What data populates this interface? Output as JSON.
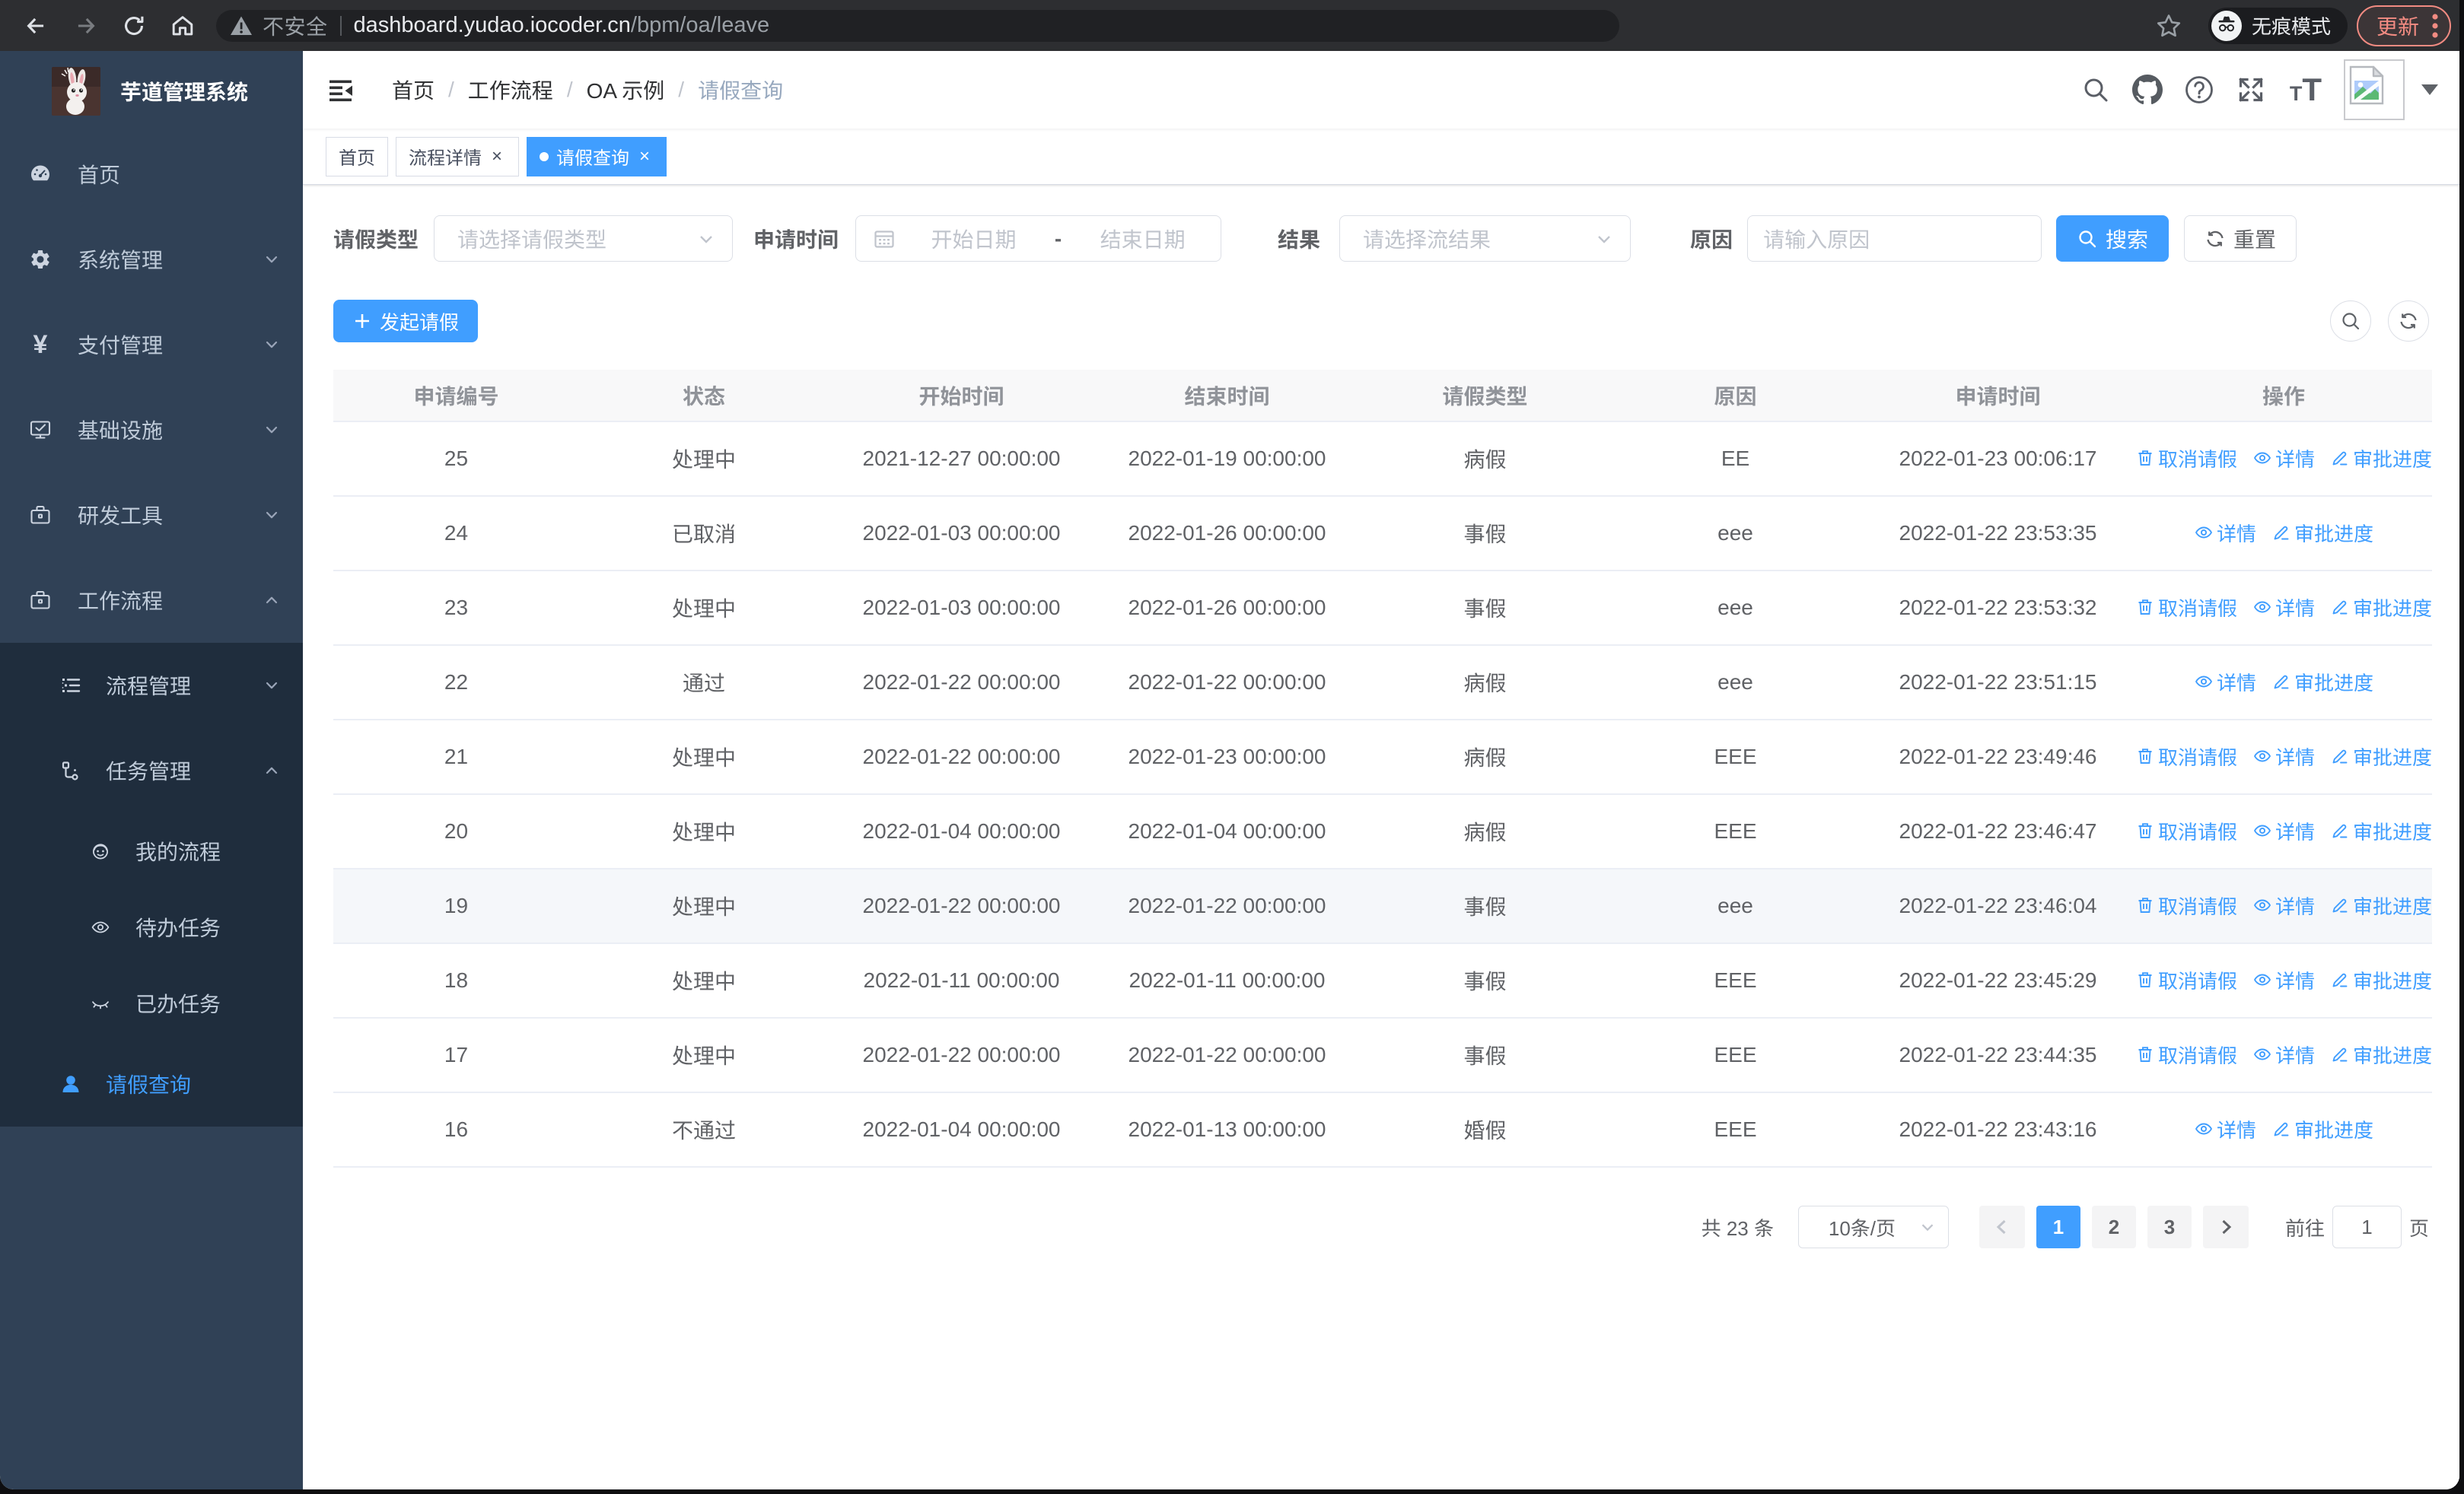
{
  "browser": {
    "security_label": "不安全",
    "url_host": "dashboard.yudao.iocoder.cn",
    "url_path": "/bpm/oa/leave",
    "incognito_label": "无痕模式",
    "update_label": "更新"
  },
  "sidebar": {
    "app_title": "芋道管理系统",
    "menu": [
      {
        "label": "首页",
        "icon": "dashboard-icon",
        "level": 1,
        "arrow": null,
        "dark": false,
        "active": false
      },
      {
        "label": "系统管理",
        "icon": "gear-icon",
        "level": 1,
        "arrow": "down",
        "dark": false,
        "active": false
      },
      {
        "label": "支付管理",
        "icon": "yen-icon",
        "level": 1,
        "arrow": "down",
        "dark": false,
        "active": false
      },
      {
        "label": "基础设施",
        "icon": "monitor-icon",
        "level": 1,
        "arrow": "down",
        "dark": false,
        "active": false
      },
      {
        "label": "研发工具",
        "icon": "briefcase-icon",
        "level": 1,
        "arrow": "down",
        "dark": false,
        "active": false
      },
      {
        "label": "工作流程",
        "icon": "briefcase-icon",
        "level": 1,
        "arrow": "up",
        "dark": false,
        "active": false
      },
      {
        "label": "流程管理",
        "icon": "list-icon",
        "level": 2,
        "arrow": "down",
        "dark": true,
        "active": false
      },
      {
        "label": "任务管理",
        "icon": "tree-icon",
        "level": 2,
        "arrow": "up",
        "dark": true,
        "active": false
      },
      {
        "label": "我的流程",
        "icon": "face-icon",
        "level": 3,
        "arrow": null,
        "dark": true,
        "active": false
      },
      {
        "label": "待办任务",
        "icon": "eye-icon",
        "level": 3,
        "arrow": null,
        "dark": true,
        "active": false
      },
      {
        "label": "已办任务",
        "icon": "eye-closed-icon",
        "level": 3,
        "arrow": null,
        "dark": true,
        "active": false
      },
      {
        "label": "请假查询",
        "icon": "user-icon",
        "level": 2,
        "arrow": null,
        "dark": true,
        "active": true
      }
    ]
  },
  "navbar": {
    "breadcrumb": [
      "首页",
      "工作流程",
      "OA 示例",
      "请假查询"
    ]
  },
  "tags": [
    {
      "label": "首页",
      "closable": false,
      "active": false
    },
    {
      "label": "流程详情",
      "closable": true,
      "active": false
    },
    {
      "label": "请假查询",
      "closable": true,
      "active": true
    }
  ],
  "filters": {
    "leave_type_label": "请假类型",
    "leave_type_placeholder": "请选择请假类型",
    "apply_time_label": "申请时间",
    "start_date_placeholder": "开始日期",
    "range_separator": "-",
    "end_date_placeholder": "结束日期",
    "result_label": "结果",
    "result_placeholder": "请选择流结果",
    "reason_label": "原因",
    "reason_placeholder": "请输入原因",
    "search_label": "搜索",
    "reset_label": "重置"
  },
  "toolbar": {
    "create_label": "发起请假"
  },
  "table": {
    "headers": [
      "申请编号",
      "状态",
      "开始时间",
      "结束时间",
      "请假类型",
      "原因",
      "申请时间",
      "操作"
    ],
    "action_labels": {
      "cancel": "取消请假",
      "detail": "详情",
      "progress": "审批进度"
    },
    "rows": [
      {
        "id": "25",
        "status": "处理中",
        "start": "2021-12-27 00:00:00",
        "end": "2022-01-19 00:00:00",
        "type": "病假",
        "reason": "EE",
        "applied": "2022-01-23 00:06:17",
        "actions": [
          "cancel",
          "detail",
          "progress"
        ],
        "highlight": false
      },
      {
        "id": "24",
        "status": "已取消",
        "start": "2022-01-03 00:00:00",
        "end": "2022-01-26 00:00:00",
        "type": "事假",
        "reason": "eee",
        "applied": "2022-01-22 23:53:35",
        "actions": [
          "detail",
          "progress"
        ],
        "highlight": false
      },
      {
        "id": "23",
        "status": "处理中",
        "start": "2022-01-03 00:00:00",
        "end": "2022-01-26 00:00:00",
        "type": "事假",
        "reason": "eee",
        "applied": "2022-01-22 23:53:32",
        "actions": [
          "cancel",
          "detail",
          "progress"
        ],
        "highlight": false
      },
      {
        "id": "22",
        "status": "通过",
        "start": "2022-01-22 00:00:00",
        "end": "2022-01-22 00:00:00",
        "type": "病假",
        "reason": "eee",
        "applied": "2022-01-22 23:51:15",
        "actions": [
          "detail",
          "progress"
        ],
        "highlight": false
      },
      {
        "id": "21",
        "status": "处理中",
        "start": "2022-01-22 00:00:00",
        "end": "2022-01-23 00:00:00",
        "type": "病假",
        "reason": "EEE",
        "applied": "2022-01-22 23:49:46",
        "actions": [
          "cancel",
          "detail",
          "progress"
        ],
        "highlight": false
      },
      {
        "id": "20",
        "status": "处理中",
        "start": "2022-01-04 00:00:00",
        "end": "2022-01-04 00:00:00",
        "type": "病假",
        "reason": "EEE",
        "applied": "2022-01-22 23:46:47",
        "actions": [
          "cancel",
          "detail",
          "progress"
        ],
        "highlight": false
      },
      {
        "id": "19",
        "status": "处理中",
        "start": "2022-01-22 00:00:00",
        "end": "2022-01-22 00:00:00",
        "type": "事假",
        "reason": "eee",
        "applied": "2022-01-22 23:46:04",
        "actions": [
          "cancel",
          "detail",
          "progress"
        ],
        "highlight": true
      },
      {
        "id": "18",
        "status": "处理中",
        "start": "2022-01-11 00:00:00",
        "end": "2022-01-11 00:00:00",
        "type": "事假",
        "reason": "EEE",
        "applied": "2022-01-22 23:45:29",
        "actions": [
          "cancel",
          "detail",
          "progress"
        ],
        "highlight": false
      },
      {
        "id": "17",
        "status": "处理中",
        "start": "2022-01-22 00:00:00",
        "end": "2022-01-22 00:00:00",
        "type": "事假",
        "reason": "EEE",
        "applied": "2022-01-22 23:44:35",
        "actions": [
          "cancel",
          "detail",
          "progress"
        ],
        "highlight": false
      },
      {
        "id": "16",
        "status": "不通过",
        "start": "2022-01-04 00:00:00",
        "end": "2022-01-13 00:00:00",
        "type": "婚假",
        "reason": "EEE",
        "applied": "2022-01-22 23:43:16",
        "actions": [
          "detail",
          "progress"
        ],
        "highlight": false
      }
    ]
  },
  "pagination": {
    "total_label": "共 23 条",
    "page_size": "10条/页",
    "pages": [
      "1",
      "2",
      "3"
    ],
    "active_page": "1",
    "goto_label": "前往",
    "goto_value": "1",
    "page_unit": "页"
  },
  "colors": {
    "primary": "#409eff",
    "sidebar_bg": "#304156",
    "sidebar_sub_bg": "#1f2d3d",
    "chrome_bg": "#2d2e31",
    "update_accent": "#f28b82"
  }
}
